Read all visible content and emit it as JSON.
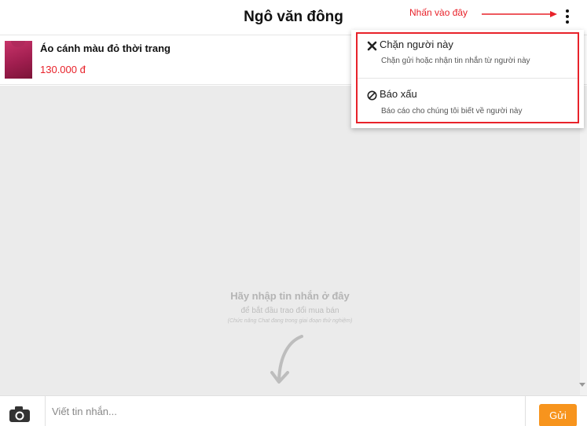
{
  "header": {
    "title": "Ngô văn đông",
    "annotation": "Nhấn vào đây",
    "menu_icon": "more-vertical-icon",
    "annotation_color": "#e8222a"
  },
  "product": {
    "name": "Áo cánh màu đỏ thời trang",
    "price": "130.000 đ",
    "price_color": "#e8222a"
  },
  "empty_state": {
    "title": "Hãy nhập tin nhắn ở đây",
    "subtitle": "để bắt đầu trao đổi mua bán",
    "note": "(Chức năng Chat đang trong giai đoạn thử nghiệm)",
    "icon": "curved-arrow-down-icon"
  },
  "menu": {
    "items": [
      {
        "icon": "close-icon",
        "title": "Chặn người này",
        "description": "Chặn gửi hoặc nhận tin nhắn từ người này"
      },
      {
        "icon": "block-icon",
        "title": "Báo xấu",
        "description": "Báo cáo cho chúng tôi biết về người này"
      }
    ]
  },
  "composer": {
    "camera_icon": "camera-icon",
    "placeholder": "Viết tin nhắn...",
    "send_label": "Gửi",
    "send_color": "#f7941d"
  }
}
